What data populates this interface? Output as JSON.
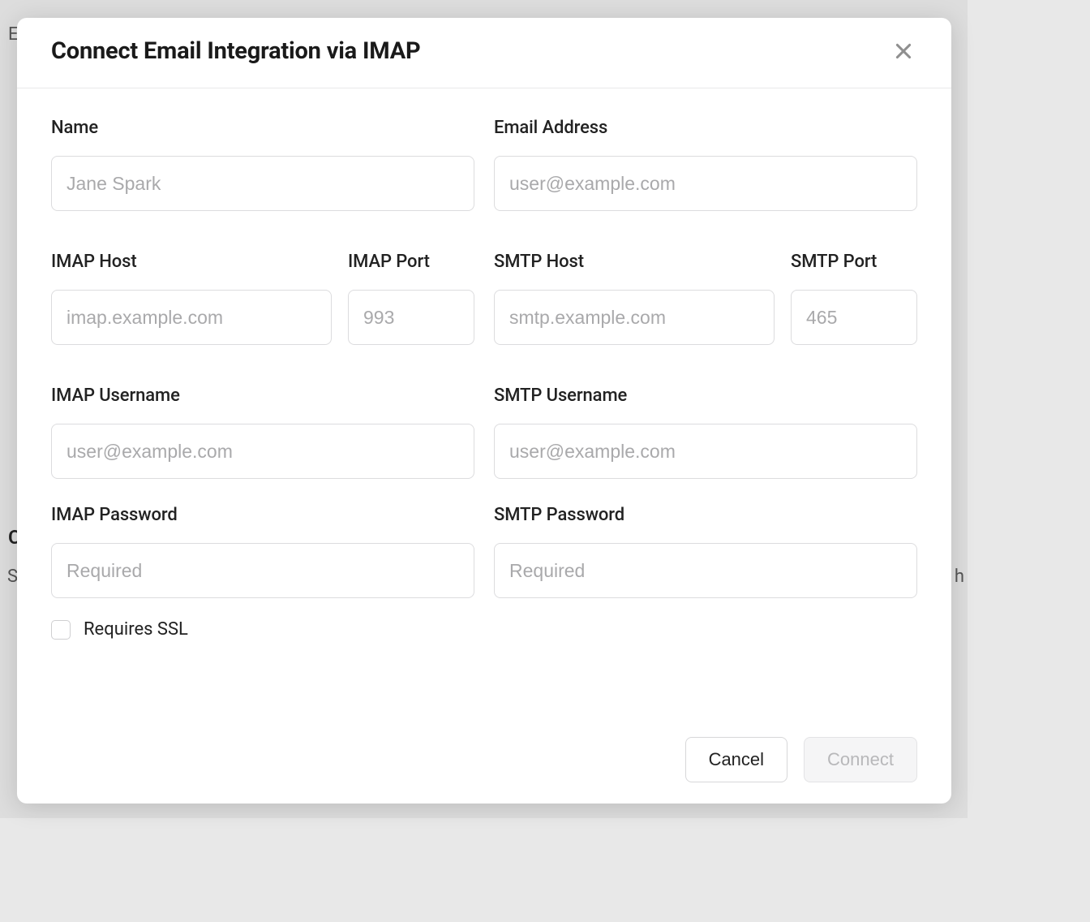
{
  "modal": {
    "title": "Connect Email Integration via IMAP",
    "labels": {
      "name": "Name",
      "email": "Email Address",
      "imap_host": "IMAP Host",
      "imap_port": "IMAP Port",
      "smtp_host": "SMTP Host",
      "smtp_port": "SMTP Port",
      "imap_username": "IMAP Username",
      "smtp_username": "SMTP Username",
      "imap_password": "IMAP Password",
      "smtp_password": "SMTP Password",
      "requires_ssl": "Requires SSL"
    },
    "placeholders": {
      "name": "Jane Spark",
      "email": "user@example.com",
      "imap_host": "imap.example.com",
      "imap_port": "993",
      "smtp_host": "smtp.example.com",
      "smtp_port": "465",
      "imap_username": "user@example.com",
      "smtp_username": "user@example.com",
      "imap_password": "Required",
      "smtp_password": "Required"
    },
    "values": {
      "name": "",
      "email": "",
      "imap_host": "",
      "imap_port": "",
      "smtp_host": "",
      "smtp_port": "",
      "imap_username": "",
      "smtp_username": "",
      "imap_password": "",
      "smtp_password": "",
      "requires_ssl": false
    },
    "buttons": {
      "cancel": "Cancel",
      "connect": "Connect"
    }
  },
  "backdrop": {
    "e": "E",
    "c": "C",
    "s": "S",
    "h": "h"
  }
}
